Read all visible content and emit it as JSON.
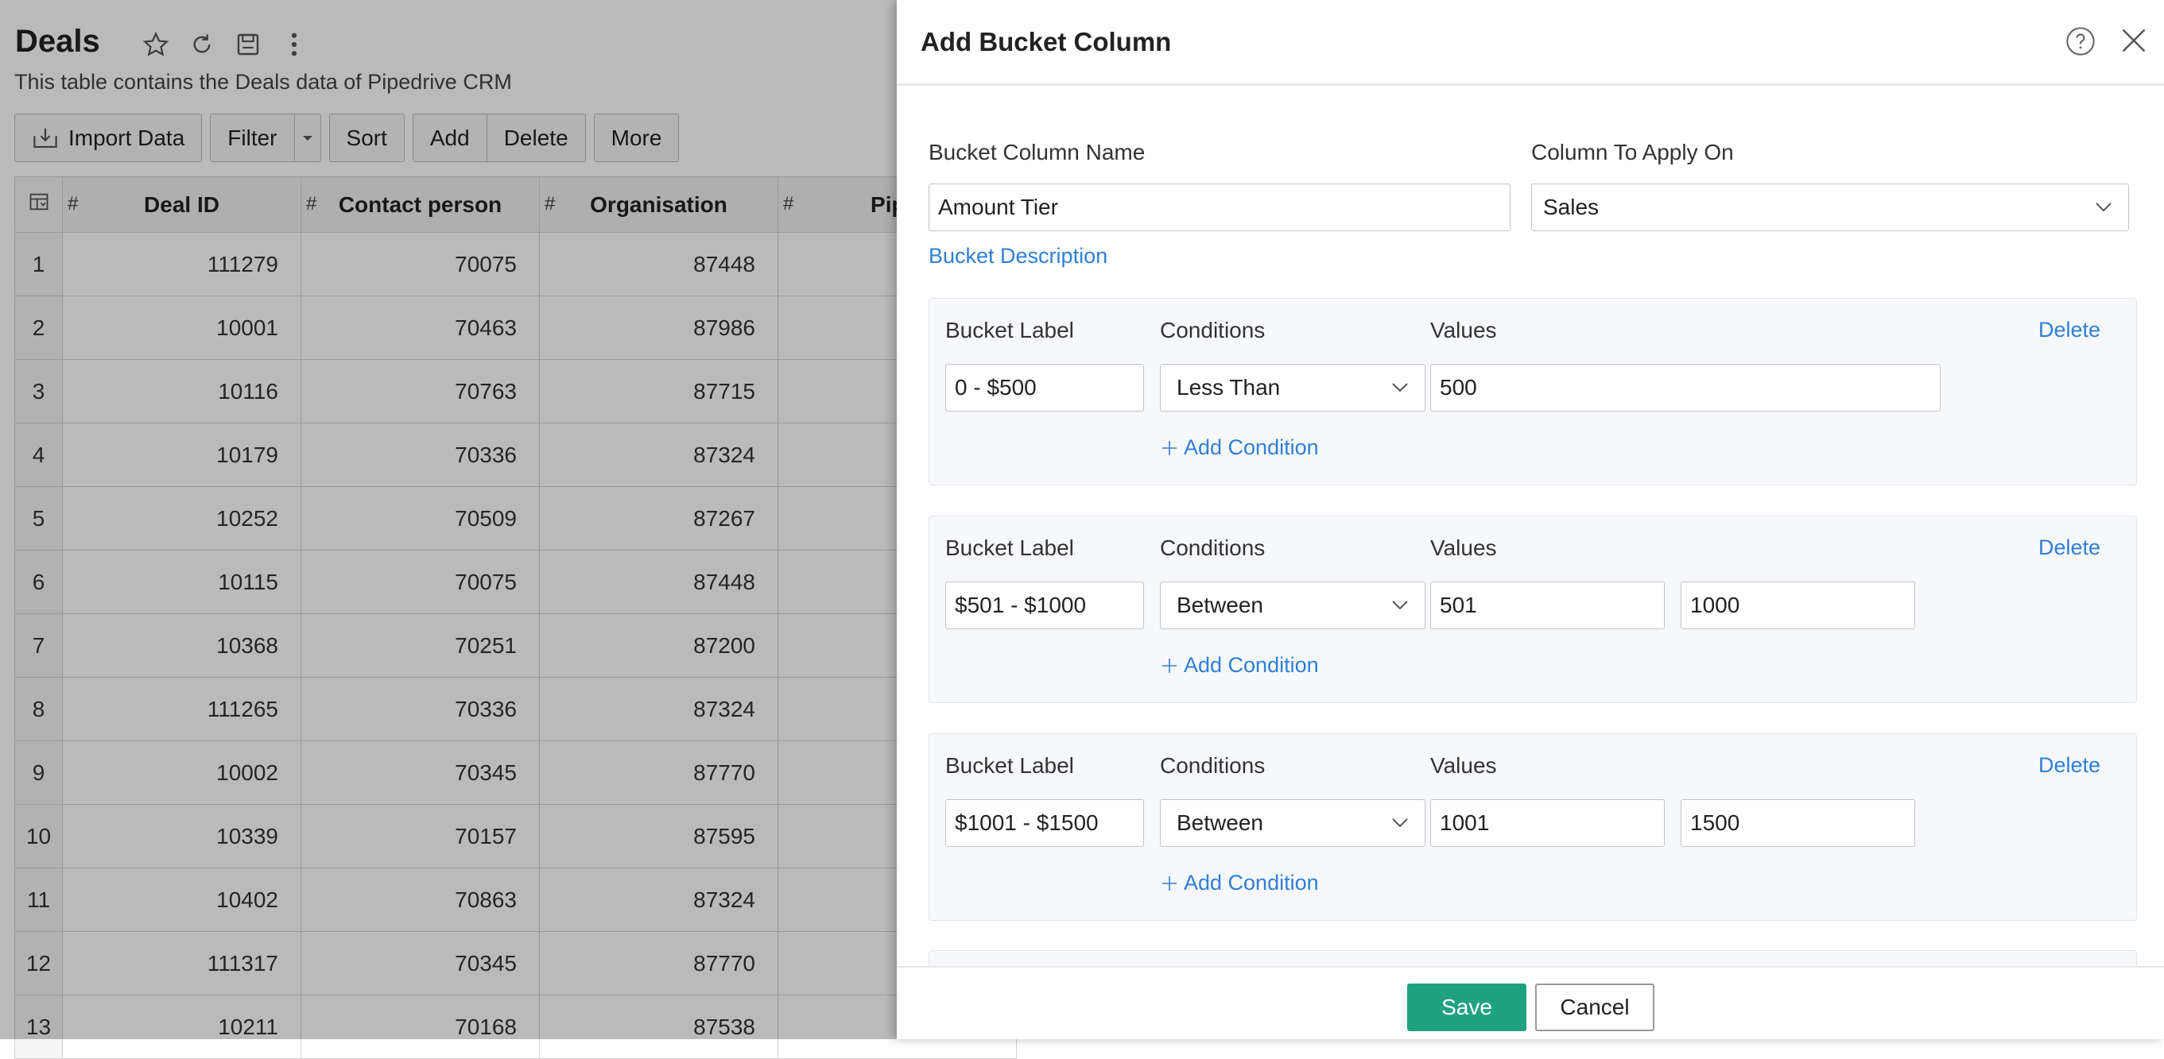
{
  "app": {
    "title": "Deals",
    "subtitle": "This table contains the Deals data of Pipedrive CRM",
    "icons": [
      "star-icon",
      "refresh-icon",
      "save-icon",
      "more-vertical-icon"
    ],
    "toolbar": {
      "import_label": "Import Data",
      "filter_label": "Filter",
      "sort_label": "Sort",
      "add_label": "Add",
      "delete_label": "Delete",
      "more_label": "More"
    },
    "table": {
      "type_marker": "#",
      "columns": [
        "Deal ID",
        "Contact person",
        "Organisation",
        "Pipel"
      ],
      "rows": [
        {
          "n": "1",
          "deal_id": "111279",
          "contact": "70075",
          "org": "87448"
        },
        {
          "n": "2",
          "deal_id": "10001",
          "contact": "70463",
          "org": "87986"
        },
        {
          "n": "3",
          "deal_id": "10116",
          "contact": "70763",
          "org": "87715"
        },
        {
          "n": "4",
          "deal_id": "10179",
          "contact": "70336",
          "org": "87324"
        },
        {
          "n": "5",
          "deal_id": "10252",
          "contact": "70509",
          "org": "87267"
        },
        {
          "n": "6",
          "deal_id": "10115",
          "contact": "70075",
          "org": "87448"
        },
        {
          "n": "7",
          "deal_id": "10368",
          "contact": "70251",
          "org": "87200"
        },
        {
          "n": "8",
          "deal_id": "111265",
          "contact": "70336",
          "org": "87324"
        },
        {
          "n": "9",
          "deal_id": "10002",
          "contact": "70345",
          "org": "87770"
        },
        {
          "n": "10",
          "deal_id": "10339",
          "contact": "70157",
          "org": "87595"
        },
        {
          "n": "11",
          "deal_id": "10402",
          "contact": "70863",
          "org": "87324"
        },
        {
          "n": "12",
          "deal_id": "111317",
          "contact": "70345",
          "org": "87770"
        },
        {
          "n": "13",
          "deal_id": "10211",
          "contact": "70168",
          "org": "87538"
        }
      ]
    }
  },
  "dialog": {
    "title": "Add Bucket Column",
    "bucket_column_name_label": "Bucket Column Name",
    "bucket_column_name_value": "Amount Tier",
    "column_to_apply_label": "Column To Apply On",
    "column_to_apply_value": "Sales",
    "bucket_description_link": "Bucket Description",
    "bucket_label_heading": "Bucket Label",
    "conditions_heading": "Conditions",
    "values_heading": "Values",
    "delete_label": "Delete",
    "add_condition_label": "Add Condition",
    "buckets": [
      {
        "label": "0 - $500",
        "condition": "Less Than",
        "values": [
          "500"
        ]
      },
      {
        "label": "$501 - $1000",
        "condition": "Between",
        "values": [
          "501",
          "1000"
        ]
      },
      {
        "label": "$1001 - $1500",
        "condition": "Between",
        "values": [
          "1001",
          "1500"
        ]
      }
    ],
    "save_label": "Save",
    "cancel_label": "Cancel"
  },
  "colors": {
    "accent_link": "#2e7fd6",
    "save_button": "#1fa37f",
    "overlay": "rgba(0,0,0,0.27)"
  }
}
